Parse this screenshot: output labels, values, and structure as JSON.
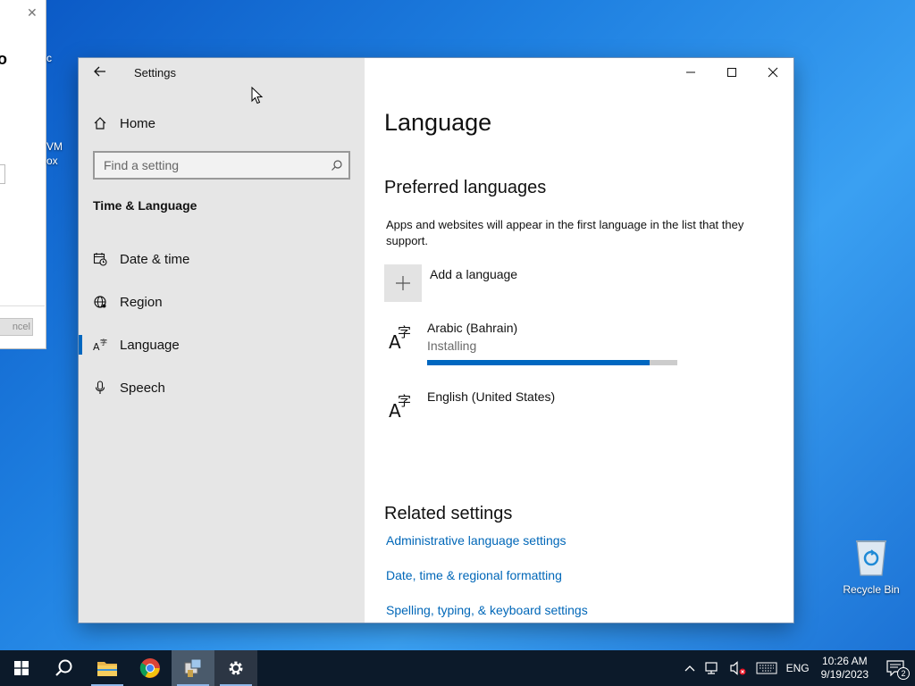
{
  "window": {
    "title": "Settings",
    "minimize_icon": "minimize-icon",
    "maximize_icon": "maximize-icon",
    "close_icon": "close-icon"
  },
  "sidebar": {
    "home_label": "Home",
    "search_placeholder": "Find a setting",
    "section_title": "Time & Language",
    "items": [
      {
        "label": "Date & time",
        "icon": "calendar-clock-icon"
      },
      {
        "label": "Region",
        "icon": "globe-icon"
      },
      {
        "label": "Language",
        "icon": "language-icon",
        "selected": true
      },
      {
        "label": "Speech",
        "icon": "microphone-icon"
      }
    ]
  },
  "main": {
    "page_title": "Language",
    "preferred_heading": "Preferred languages",
    "description": "Apps and websites will appear in the first language in the list that they support.",
    "add_language_label": "Add a language",
    "languages": [
      {
        "name": "Arabic (Bahrain)",
        "status": "Installing",
        "progress": 0.89
      },
      {
        "name": "English (United States)"
      }
    ],
    "related_heading": "Related settings",
    "links": [
      "Administrative language settings",
      "Date, time & regional formatting",
      "Spelling, typing, & keyboard settings"
    ]
  },
  "background_dialog": {
    "cancel_label": "ncel"
  },
  "desktop": {
    "peek_texts": [
      "c",
      "VM",
      "ox"
    ],
    "recycle_bin_label": "Recycle Bin"
  },
  "taskbar": {
    "items": [
      "start-icon",
      "search-icon",
      "file-explorer-icon",
      "chrome-icon",
      "network-install-icon",
      "settings-icon"
    ],
    "tray": {
      "language": "ENG",
      "time": "10:26 AM",
      "date": "9/19/2023",
      "notification_count": "2"
    }
  },
  "colors": {
    "accent": "#0067c0",
    "link": "#0067b8",
    "sidebar_bg": "#e6e6e6",
    "taskbar_bg": "#0c1a2a"
  }
}
